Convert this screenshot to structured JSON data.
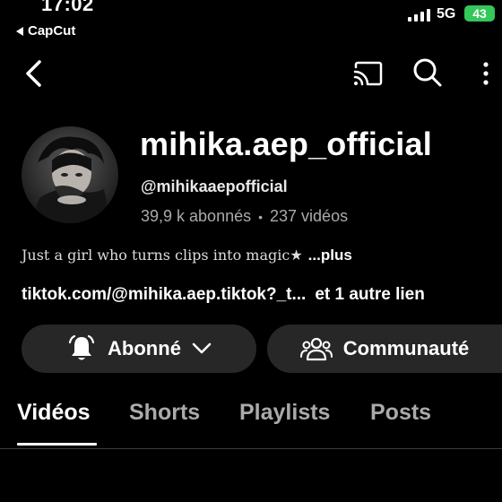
{
  "status_bar": {
    "time": "17:02",
    "back_app": "CapCut",
    "network": "5G",
    "battery": "43"
  },
  "toolbar": {
    "icons": [
      "back-arrow-icon",
      "cast-icon",
      "search-icon",
      "more-vertical-icon"
    ]
  },
  "channel": {
    "name": "mihika.aep_official",
    "handle": "@mihikaaepofficial",
    "subscribers": "39,9 k abonnés",
    "separator": "•",
    "videos": "237 vidéos",
    "bio": "Just a girl who turns clips into magic★",
    "bio_more": "...plus",
    "link": "tiktok.com/@mihika.aep.tiktok?_t...",
    "more_links": "et 1 autre lien"
  },
  "actions": {
    "subscribed_label": "Abonné",
    "community_label": "Communauté"
  },
  "tabs": [
    {
      "label": "Vidéos",
      "active": true
    },
    {
      "label": "Shorts",
      "active": false
    },
    {
      "label": "Playlists",
      "active": false
    },
    {
      "label": "Posts",
      "active": false
    }
  ],
  "colors": {
    "background": "#000000",
    "pill_bg": "#272727",
    "muted_text": "#aaaaaa",
    "battery": "#34c759"
  }
}
